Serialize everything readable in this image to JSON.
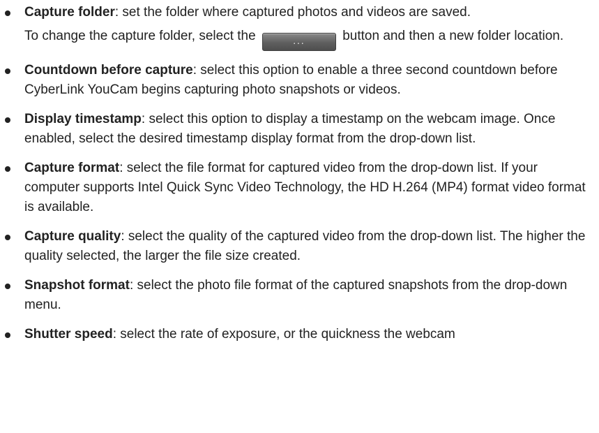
{
  "items": [
    {
      "term": "Capture folder",
      "text": ": set the folder where captured photos and videos are saved.",
      "sub_before": "To change the capture folder, select the ",
      "button_label": "...",
      "sub_after": " button and then a new folder location."
    },
    {
      "term": "Countdown before capture",
      "text": ": select this option to enable a three second countdown before CyberLink YouCam begins capturing photo snapshots or videos."
    },
    {
      "term": "Display timestamp",
      "text": ": select this option to display a timestamp on the webcam image. Once enabled, select the desired timestamp display format from the drop-down list."
    },
    {
      "term": "Capture format",
      "text": ": select the file format for captured video from the drop-down list. If your computer supports Intel Quick Sync Video Technology, the HD H.264 (MP4) format video format is available."
    },
    {
      "term": "Capture quality",
      "text": ": select the quality of the captured video from the drop-down list. The higher the quality selected, the larger the file size created."
    },
    {
      "term": "Snapshot format",
      "text": ": select the photo file format of the captured snapshots from the drop-down menu."
    },
    {
      "term": "Shutter speed",
      "text": ": select the rate of exposure, or the quickness the webcam"
    }
  ]
}
